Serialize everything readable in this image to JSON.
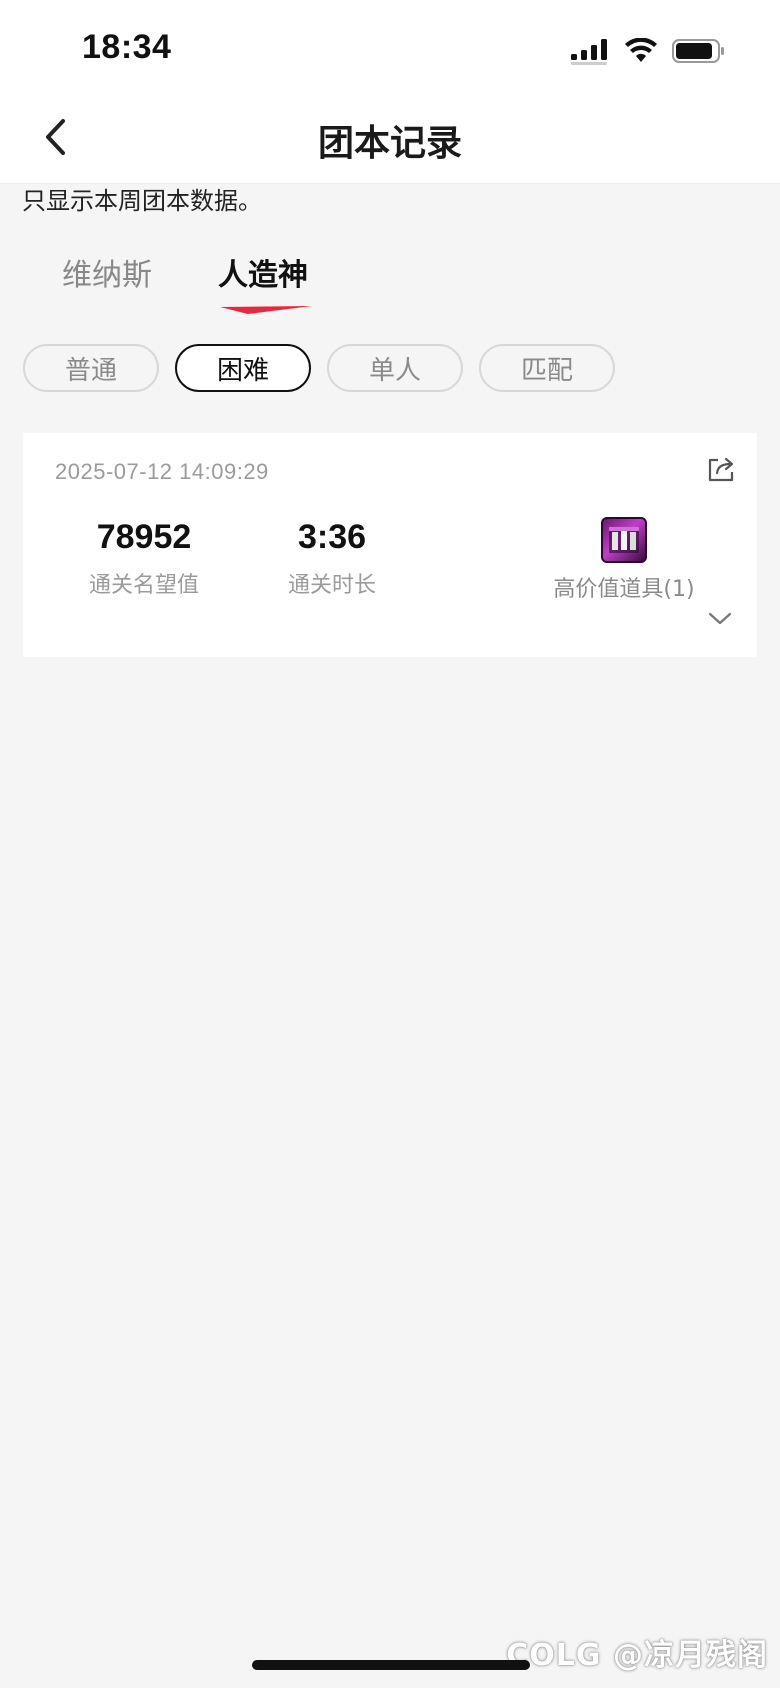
{
  "status_bar": {
    "time": "18:34"
  },
  "nav": {
    "title": "团本记录"
  },
  "notice": "只显示本周团本数据。",
  "tabs": [
    {
      "label": "维纳斯",
      "active": false
    },
    {
      "label": "人造神",
      "active": true
    }
  ],
  "filters": [
    {
      "label": "普通",
      "active": false
    },
    {
      "label": "困难",
      "active": true
    },
    {
      "label": "单人",
      "active": false
    },
    {
      "label": "匹配",
      "active": false
    }
  ],
  "record": {
    "datetime": "2025-07-12 14:09:29",
    "fame_value": "78952",
    "fame_label": "通关名望值",
    "duration_value": "3:36",
    "duration_label": "通关时长",
    "items_label": "高价值道具(1)"
  },
  "watermark": "COLG @凉月残阁",
  "colors": {
    "accent_red": "#e8283c",
    "background": "#f5f5f5"
  }
}
